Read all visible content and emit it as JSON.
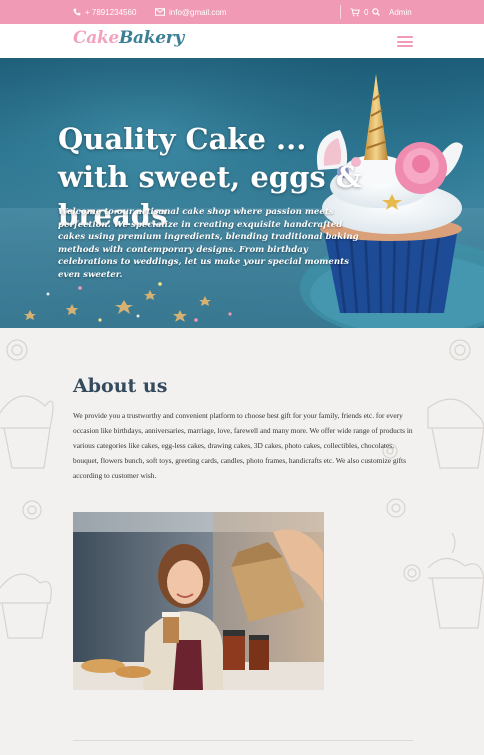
{
  "topbar": {
    "phone": "+ 7891234560",
    "email": "info@gmail.com",
    "cart_count": "0",
    "admin": "Admin"
  },
  "logo": {
    "part1": "Cake",
    "part2": "Bakery"
  },
  "hero": {
    "title_line1": "Quality Cake ...",
    "title_line2": "with sweet, eggs & breads",
    "description": "Welcome to our artisanal cake shop where passion meets perfection. We specialize in creating exquisite handcrafted cakes using premium ingredients, blending traditional baking methods with contemporary designs. From birthday celebrations to weddings, let us make your special moments even sweeter."
  },
  "about": {
    "title": "About us",
    "text": "We provide you a trustworthy and convenient platform to choose best gift for your family, friends etc. for every occasion like birthdays, anniversaries, marriage, love, farewell and many more. We offer wide range of products in various categories like cakes, egg-less cakes, drawing cakes, 3D cakes, photo cakes, collectibles, chocolates, bouquet, flowers bunch, soft toys, greeting cards, candles, photo frames, handicrafts etc. We also customize gifts according to customer wish."
  },
  "colors": {
    "topbar": "#f09ab5",
    "logo_pink": "#f3a2bd",
    "logo_teal": "#3a7f95",
    "heading": "#344a5e"
  }
}
